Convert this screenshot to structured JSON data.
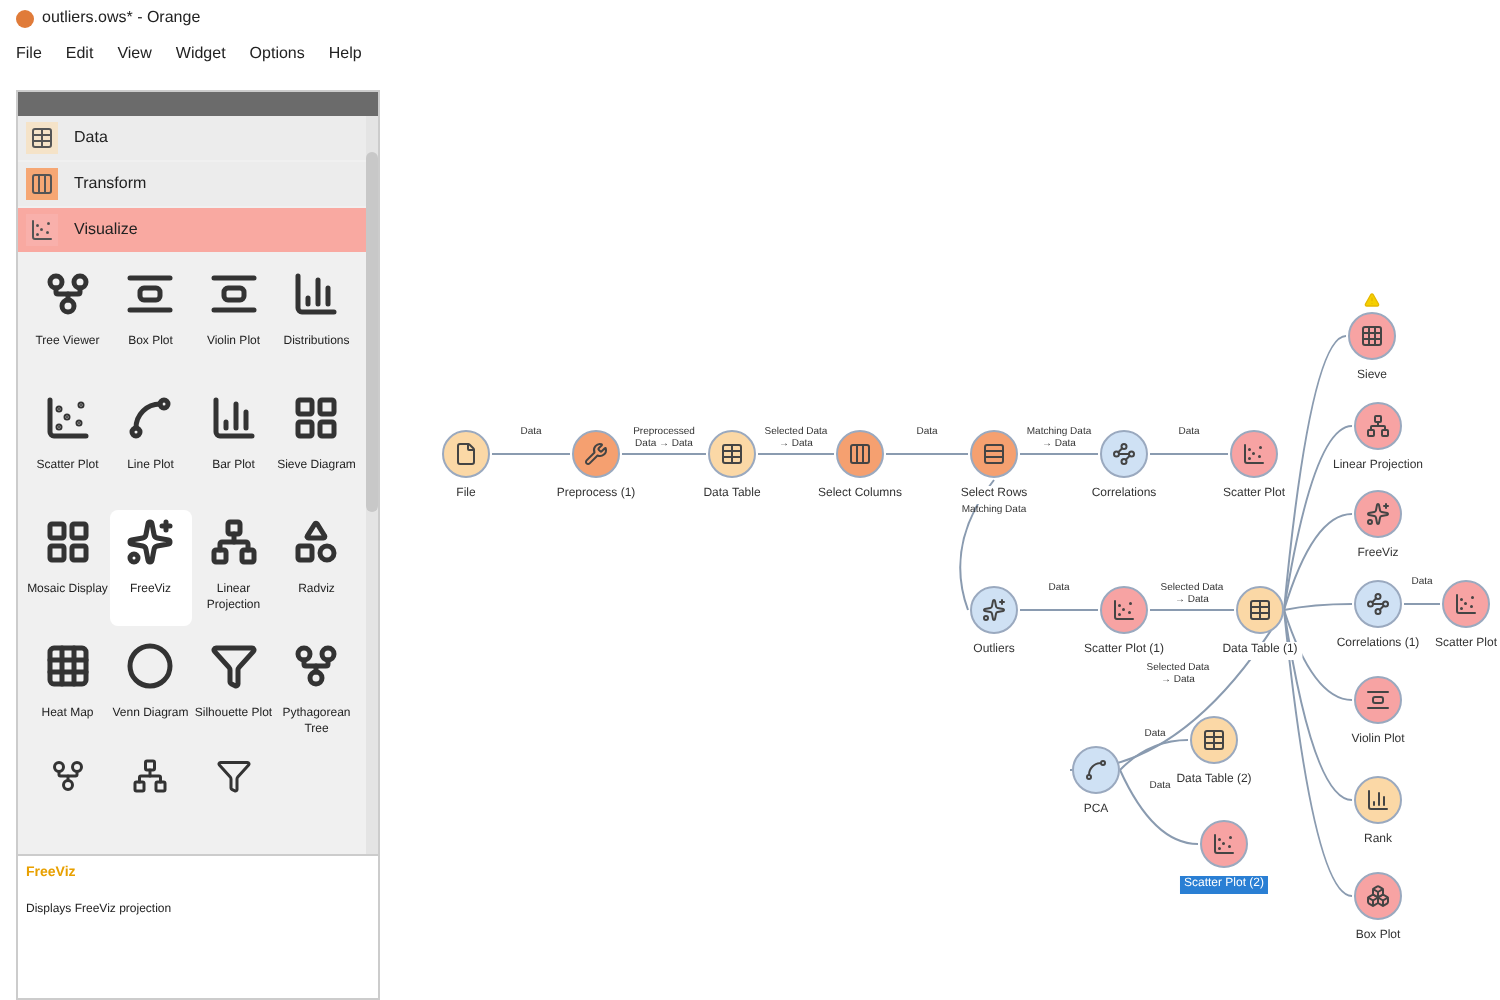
{
  "window": {
    "title": "outliers.ows* - Orange"
  },
  "menu": [
    "File",
    "Edit",
    "View",
    "Widget",
    "Options",
    "Help"
  ],
  "categories": [
    {
      "label": "Data",
      "kind": "data",
      "selected": false
    },
    {
      "label": "Transform",
      "kind": "transform",
      "selected": false
    },
    {
      "label": "Visualize",
      "kind": "visualize",
      "selected": true
    }
  ],
  "widgets": [
    {
      "label": "Tree Viewer",
      "selected": false
    },
    {
      "label": "Box Plot",
      "selected": false
    },
    {
      "label": "Violin Plot",
      "selected": false
    },
    {
      "label": "Distributions",
      "selected": false
    },
    {
      "label": "Scatter Plot",
      "selected": false
    },
    {
      "label": "Line Plot",
      "selected": false
    },
    {
      "label": "Bar Plot",
      "selected": false
    },
    {
      "label": "Sieve Diagram",
      "selected": false
    },
    {
      "label": "Mosaic Display",
      "selected": false
    },
    {
      "label": "FreeViz",
      "selected": true
    },
    {
      "label": "Linear Projection",
      "selected": false
    },
    {
      "label": "Radviz",
      "selected": false
    },
    {
      "label": "Heat Map",
      "selected": false
    },
    {
      "label": "Venn Diagram",
      "selected": false
    },
    {
      "label": "Silhouette Plot",
      "selected": false
    },
    {
      "label": "Pythagorean Tree",
      "selected": false
    }
  ],
  "description": {
    "title": "FreeViz",
    "text": "Displays FreeViz projection"
  },
  "nodes": [
    {
      "label": "File",
      "kind": "data",
      "selected": false
    },
    {
      "label": "Preprocess (1)",
      "kind": "transform",
      "selected": false
    },
    {
      "label": "Data Table",
      "kind": "data",
      "selected": false
    },
    {
      "label": "Select Columns",
      "kind": "transform",
      "selected": false
    },
    {
      "label": "Select Rows",
      "kind": "transform",
      "selected": false
    },
    {
      "label": "Correlations",
      "kind": "unsupervised",
      "selected": false
    },
    {
      "label": "Scatter Plot",
      "kind": "visualize",
      "selected": false
    },
    {
      "label": "Outliers",
      "kind": "unsupervised",
      "selected": false
    },
    {
      "label": "Scatter Plot (1)",
      "kind": "visualize",
      "selected": false
    },
    {
      "label": "Data Table (1)",
      "kind": "data",
      "selected": false
    },
    {
      "label": "PCA",
      "kind": "unsupervised",
      "selected": false
    },
    {
      "label": "Data Table (2)",
      "kind": "data",
      "selected": false
    },
    {
      "label": "Scatter Plot (2)",
      "kind": "visualize",
      "selected": true
    },
    {
      "label": "Sieve",
      "kind": "visualize",
      "selected": false,
      "warning": true
    },
    {
      "label": "Linear Projection",
      "kind": "visualize",
      "selected": false
    },
    {
      "label": "FreeViz",
      "kind": "visualize",
      "selected": false
    },
    {
      "label": "Correlations (1)",
      "kind": "unsupervised",
      "selected": false
    },
    {
      "label": "Scatter Plot",
      "kind": "visualize",
      "selected": false
    },
    {
      "label": "Violin Plot",
      "kind": "visualize",
      "selected": false
    },
    {
      "label": "Rank",
      "kind": "data",
      "selected": false
    },
    {
      "label": "Box Plot",
      "kind": "visualize",
      "selected": false
    }
  ],
  "links": [
    {
      "label": "Data"
    },
    {
      "label": "Preprocessed Data → Data"
    },
    {
      "label": "Selected Data → Data"
    },
    {
      "label": "Data"
    },
    {
      "label": "Matching Data → Data"
    },
    {
      "label": "Data"
    },
    {
      "label": "Matching Data"
    },
    {
      "label": "Data"
    },
    {
      "label": "Selected Data → Data"
    },
    {
      "label": "Selected Data → Data"
    },
    {
      "label": "Data"
    },
    {
      "label": "Data"
    },
    {
      "label": "Data"
    }
  ]
}
